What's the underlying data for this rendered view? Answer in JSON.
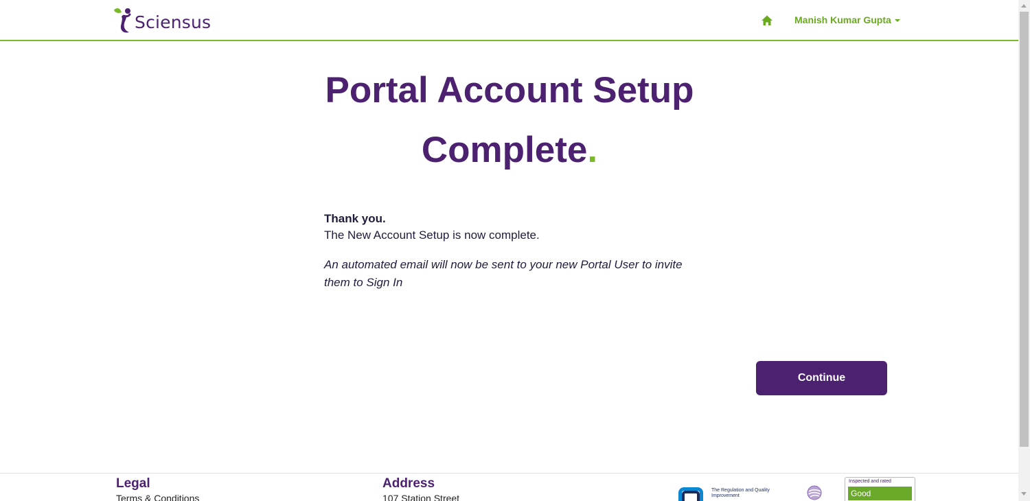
{
  "header": {
    "brand": "Sciensus",
    "user_name": "Manish Kumar Gupta",
    "home_icon": "home-icon"
  },
  "main": {
    "title_text": "Portal Account Setup Complete",
    "title_dot": ".",
    "thanks": "Thank you.",
    "complete_text": "The New Account Setup is now complete.",
    "email_text": "An automated email will now be sent to your new Portal User to invite them to Sign In",
    "continue_label": "Continue"
  },
  "footer": {
    "legal_heading": "Legal",
    "terms_link": "Terms & Conditions",
    "address_heading": "Address",
    "address_line1": "107 Station Street",
    "rqia_text": "The Regulation and Quality Improvement",
    "cqc_caption": "Inspected and rated",
    "cqc_rating": "Good"
  },
  "colors": {
    "brand_purple": "#4b2170",
    "brand_green": "#7ab929",
    "rating_green": "#6aa829",
    "rqia_blue": "#0a89d2"
  }
}
